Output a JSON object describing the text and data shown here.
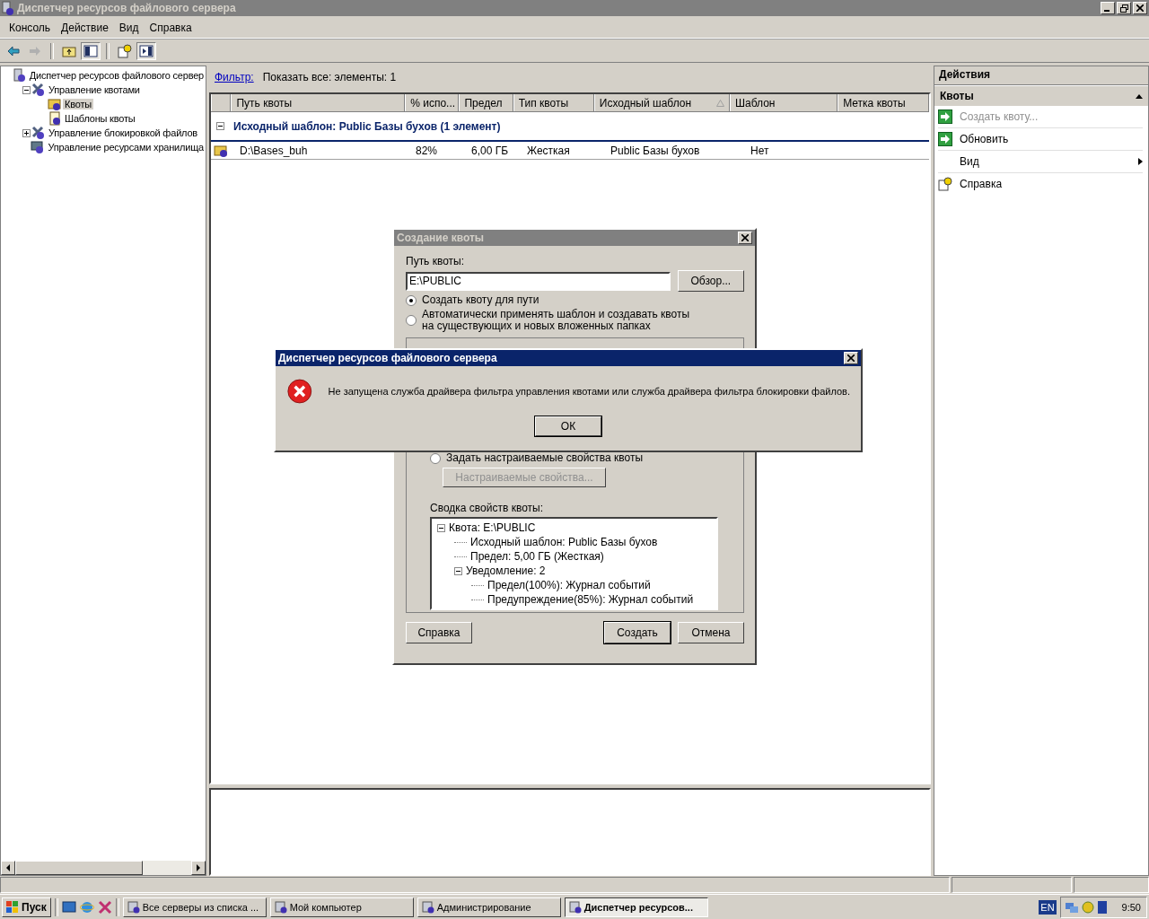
{
  "window": {
    "title": "Диспетчер ресурсов файлового сервера"
  },
  "menu": [
    "Консоль",
    "Действие",
    "Вид",
    "Справка"
  ],
  "tree": [
    {
      "label": "Диспетчер ресурсов файлового сервер",
      "kind": "server",
      "selected": false,
      "children": [
        {
          "label": "Управление квотами",
          "kind": "tools",
          "expanded": true,
          "selected": false,
          "children": [
            {
              "label": "Квоты",
              "kind": "folder",
              "selected": true
            },
            {
              "label": "Шаблоны квоты",
              "kind": "template",
              "selected": false
            }
          ]
        },
        {
          "label": "Управление блокировкой файлов",
          "kind": "tools",
          "expanded": false,
          "selected": false
        },
        {
          "label": "Управление ресурсами хранилища",
          "kind": "storage",
          "selected": false
        }
      ]
    }
  ],
  "filter": {
    "link": "Фильтр:",
    "text": "Показать все: элементы: 1"
  },
  "table": {
    "columns": [
      {
        "label": "Путь квоты",
        "sorted": false
      },
      {
        "label": "% испо...",
        "sorted": false
      },
      {
        "label": "Предел",
        "sorted": false
      },
      {
        "label": "Тип квоты",
        "sorted": false
      },
      {
        "label": "Исходный шаблон",
        "sorted": true
      },
      {
        "label": "Шаблон",
        "sorted": false
      },
      {
        "label": "Метка квоты",
        "sorted": false
      }
    ],
    "group": {
      "label": "Исходный шаблон: Public Базы бухов (1 элемент)",
      "expanded": true
    },
    "rows": [
      {
        "cells": [
          "D:\\Bases_buh",
          "82%",
          "6,00 ГБ",
          "Жесткая",
          "Public Базы бухов",
          "Нет"
        ]
      }
    ]
  },
  "actions": {
    "title": "Действия",
    "section": "Квоты",
    "items": [
      {
        "label": "Создать квоту...",
        "kind": "arrow",
        "disabled": true
      },
      {
        "label": "Обновить",
        "kind": "arrow",
        "disabled": false
      },
      {
        "label": "Вид",
        "kind": "submenu",
        "disabled": false
      },
      {
        "label": "Справка",
        "kind": "help",
        "disabled": false
      }
    ]
  },
  "create_dialog": {
    "title": "Создание квоты",
    "path_label": "Путь квоты:",
    "path_value": "E:\\PUBLIC",
    "browse": "Обзор...",
    "options": [
      {
        "label": "Создать квоту для пути",
        "selected": true
      },
      {
        "label": "Автоматически применять шаблон и создавать квоты на существующих и новых вложенных папках",
        "selected": false
      }
    ],
    "custom_option": {
      "label": "Задать настраиваемые свойства квоты",
      "selected": false
    },
    "custom_button": {
      "label": "Настраиваемые свойства...",
      "disabled": true
    },
    "summary_label": "Сводка свойств квоты:",
    "summary": [
      {
        "label": "Квота: E:\\PUBLIC",
        "expanded": true,
        "children": [
          {
            "label": "Исходный шаблон: Public Базы бухов"
          },
          {
            "label": "Предел: 5,00 ГБ (Жесткая)"
          },
          {
            "label": "Уведомление: 2",
            "expanded": true,
            "children": [
              {
                "label": "Предел(100%): Журнал событий"
              },
              {
                "label": "Предупреждение(85%): Журнал событий"
              }
            ]
          }
        ]
      }
    ],
    "buttons": [
      {
        "label": "Справка",
        "kind": "help"
      },
      {
        "label": "Создать",
        "kind": "default"
      },
      {
        "label": "Отмена",
        "kind": "cancel"
      }
    ]
  },
  "message_box": {
    "title": "Диспетчер ресурсов файлового сервера",
    "text": "Не запущена служба драйвера фильтра управления квотами или служба драйвера фильтра блокировки файлов.",
    "button": "ОК"
  },
  "taskbar": {
    "start": "Пуск",
    "tasks": [
      {
        "label": "Все серверы из списка ...",
        "selected": false
      },
      {
        "label": "Мой компьютер",
        "selected": false
      },
      {
        "label": "Администрирование",
        "selected": false
      },
      {
        "label": "Диспетчер ресурсов...",
        "selected": true
      }
    ],
    "lang": "EN",
    "time": "9:50"
  }
}
